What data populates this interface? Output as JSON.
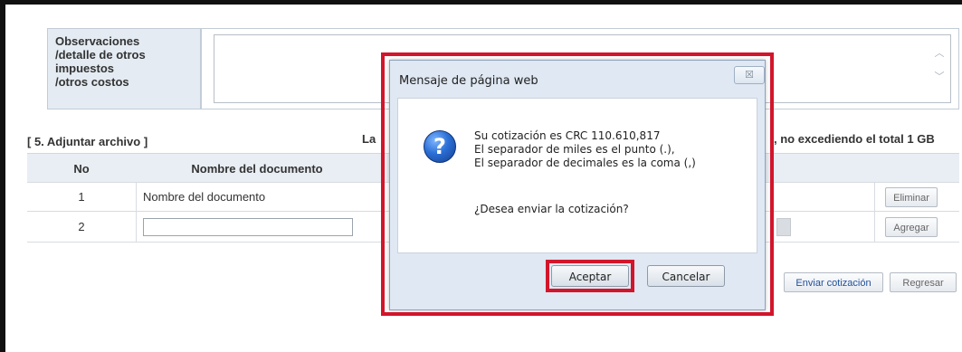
{
  "observations": {
    "label_lines": [
      "Observaciones",
      "/detalle de otros",
      "impuestos",
      "/otros costos"
    ],
    "value": ""
  },
  "attachments": {
    "section_title": "[ 5. Adjuntar archivo ]",
    "notice_left": "La",
    "notice_right": ", no excediendo el total 1 GB",
    "headers": {
      "no": "No",
      "name": "Nombre del documento"
    },
    "rows": [
      {
        "no": "1",
        "name": "Nombre del documento",
        "action": "Eliminar"
      },
      {
        "no": "2",
        "name": "",
        "action": "Agregar"
      }
    ]
  },
  "footer_buttons": {
    "send": "Enviar cotización",
    "back": "Regresar"
  },
  "dialog": {
    "title": "Mensaje de página web",
    "close_label": "☒",
    "icon": "question-icon",
    "lines": [
      "Su cotización es CRC 110.610,817",
      "El separador de miles es el punto (.),",
      "El separador de decimales es la coma (,)"
    ],
    "question": "¿Desea enviar la cotización?",
    "ok_label": "Aceptar",
    "cancel_label": "Cancelar"
  },
  "colors": {
    "highlight": "#d2152b",
    "dialog_bg": "#dfe8f3",
    "header_bg": "#e4ebf3"
  }
}
